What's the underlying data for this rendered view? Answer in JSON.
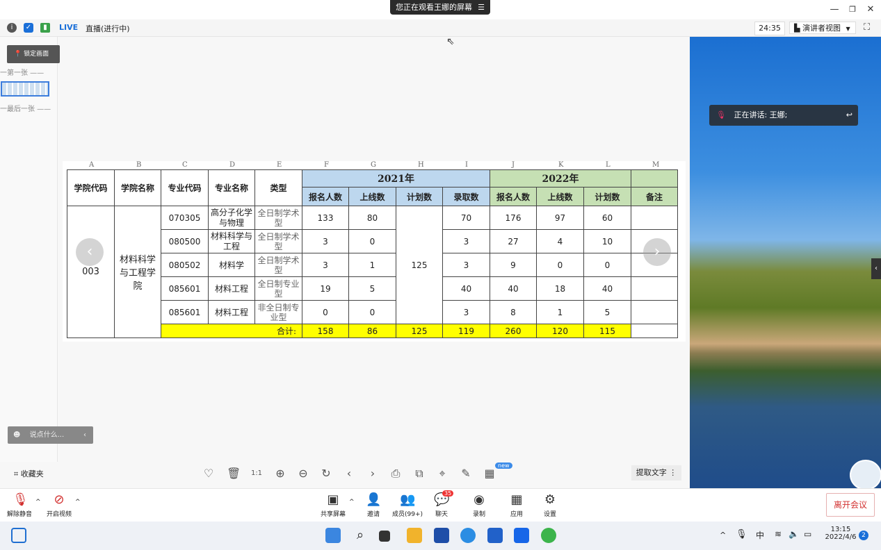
{
  "window": {
    "share_banner": "您正在观看王娜的屏幕",
    "banner_menu_glyph": "☰"
  },
  "toolbar": {
    "live": "LIVE",
    "live_status": "直播(进行中)",
    "timer": "24:35",
    "view_mode": "演讲者视图"
  },
  "thumbs": {
    "lock_tip": "锁定画面",
    "first": "一第一张 ——",
    "last": "一最后一张 ——"
  },
  "sheet": {
    "col_letters": [
      "A",
      "B",
      "C",
      "D",
      "E",
      "F",
      "G",
      "H",
      "I",
      "J",
      "K",
      "L",
      "M"
    ],
    "headers": {
      "college_code": "学院代码",
      "college_name": "学院名称",
      "major_code": "专业代码",
      "major_name": "专业名称",
      "type": "类型",
      "year_2021": "2021年",
      "year_2022": "2022年",
      "applicants": "报名人数",
      "passed": "上线数",
      "plan": "计划数",
      "admitted": "录取数",
      "remarks": "备注"
    },
    "college_code": "003",
    "college_name": "材料科学与工程学院",
    "plan_2021_merged": "125",
    "rows": [
      {
        "code": "070305",
        "name": "高分子化学与物理",
        "type": "全日制学术型",
        "a21": "133",
        "p21": "80",
        "r21": "70",
        "a22": "176",
        "p22": "97",
        "plan22": "60"
      },
      {
        "code": "080500",
        "name": "材料科学与工程",
        "type": "全日制学术型",
        "a21": "3",
        "p21": "0",
        "r21": "3",
        "a22": "27",
        "p22": "4",
        "plan22": "10"
      },
      {
        "code": "080502",
        "name": "材料学",
        "type": "全日制学术型",
        "a21": "3",
        "p21": "1",
        "r21": "3",
        "a22": "9",
        "p22": "0",
        "plan22": "0"
      },
      {
        "code": "085601",
        "name": "材料工程",
        "type": "全日制专业型",
        "a21": "19",
        "p21": "5",
        "r21": "40",
        "a22": "40",
        "p22": "18",
        "plan22": "40"
      },
      {
        "code": "085601",
        "name": "材料工程",
        "type": "非全日制专业型",
        "a21": "0",
        "p21": "0",
        "r21": "3",
        "a22": "8",
        "p22": "1",
        "plan22": "5"
      }
    ],
    "total": {
      "label": "合计:",
      "a21": "158",
      "p21": "86",
      "plan21": "125",
      "r21": "119",
      "a22": "260",
      "p22": "120",
      "plan22": "115"
    }
  },
  "chat": {
    "placeholder": "说点什么..."
  },
  "viewer": {
    "favorites": "收藏夹",
    "extract_text": "提取文字",
    "new_badge": "new"
  },
  "speaker": {
    "label": "正在讲话: 王娜;"
  },
  "controls": {
    "unmute": "解除静音",
    "video": "开启视频",
    "share": "共享屏幕",
    "invite": "邀请",
    "members": "成员(99+)",
    "chat": "聊天",
    "chat_badge": "35",
    "record": "录制",
    "apps": "应用",
    "settings": "设置",
    "leave": "离开会议"
  },
  "taskbar": {
    "time": "13:15",
    "date": "2022/4/6",
    "ime": "中",
    "notif": "2"
  },
  "colors": {
    "accent": "#1a6fd8",
    "year2021": "#bdd7ee",
    "year2022": "#c6e0b4",
    "total": "#ffff00",
    "leave": "#d2302f"
  }
}
